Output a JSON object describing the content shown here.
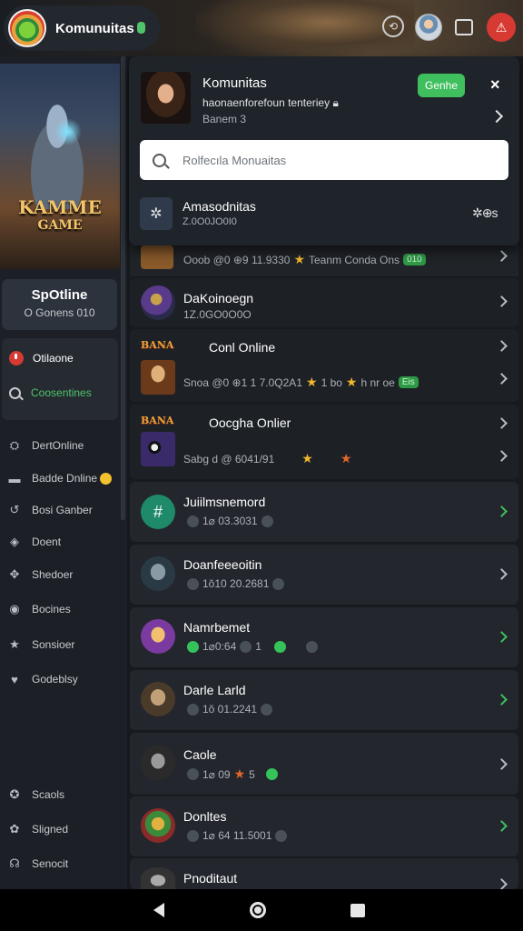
{
  "app": {
    "title": "Komunuitas"
  },
  "topbar": {
    "icons": [
      "sync-icon",
      "avatar",
      "window-icon",
      "alert-icon"
    ]
  },
  "sidebar": {
    "banner": {
      "title": "KAMME",
      "subtitle": "GAME"
    },
    "profile": {
      "name": "SpOtline",
      "status": "O Gonens 010"
    },
    "status": {
      "online": "Otilaone",
      "search": "Coosentines"
    },
    "items": [
      {
        "label": "DertOnline",
        "icon": "gamepad-icon"
      },
      {
        "label": "Badde Dnline",
        "icon": "folder-icon"
      },
      {
        "label": "Bosi Ganber",
        "icon": "link-icon"
      },
      {
        "label": "Doent",
        "icon": "shield-icon"
      },
      {
        "label": "Shedoer",
        "icon": "puzzle-icon"
      },
      {
        "label": "Bocines",
        "icon": "circle-icon"
      },
      {
        "label": "Sonsioer",
        "icon": "star-icon"
      },
      {
        "label": "Godeblsy",
        "icon": "heart-icon"
      },
      {
        "label": "Scaols",
        "icon": "controller-icon"
      },
      {
        "label": "Sligned",
        "icon": "gear-icon"
      },
      {
        "label": "Senocit",
        "icon": "headset-icon"
      }
    ]
  },
  "overlay": {
    "title": "Komunitas",
    "line1": "haonaenforefoun tenteriey",
    "line2": "Banem 3",
    "join": "Genhe",
    "close": "×",
    "search_placeholder": "Rolfecıla Monuaitas",
    "item_title": "Amasodnitas",
    "item_sub": "Z.0O0JO0I0",
    "item_action": "✲⊕s"
  },
  "list": {
    "row0": {
      "sub": "Ooob @0 ⊕9 11.9330",
      "mid": "Teanm Conda Ons",
      "pill": "010"
    },
    "row1": {
      "title": "DaKoinoegn",
      "sub": "1Z.0GO0O0O"
    },
    "row2": {
      "tag": "BANA",
      "title": "Conl Online",
      "sub": "Snoa @0 ⊕1 1 7.0Q2A1",
      "mid": "1 bo",
      "mid2": "h nr oe",
      "pill": "Eis"
    },
    "row3": {
      "tag": "BANA",
      "title": "Oocgha Onlier",
      "sub": "Sabg d @ 6041/91"
    },
    "row4": {
      "title": "Juiilmsnemord",
      "sub": "1⌀ 03.3031"
    },
    "row5": {
      "title": "Doanfeeeoitin",
      "sub": "1ŏ10 20.2681"
    },
    "row6": {
      "title": "Namrbemet",
      "sub": "1⌀0:64",
      "sub2": "1"
    },
    "row7": {
      "title": "Darle Larld",
      "sub": "1ŏ 01.2241"
    },
    "row8": {
      "title": "Caole",
      "sub": "1⌀ 09",
      "sub2": "5"
    },
    "row9": {
      "title": "Donltes",
      "sub": "1⌀ 64 11.5001"
    },
    "row10": {
      "title": "Pnoditaut"
    }
  }
}
